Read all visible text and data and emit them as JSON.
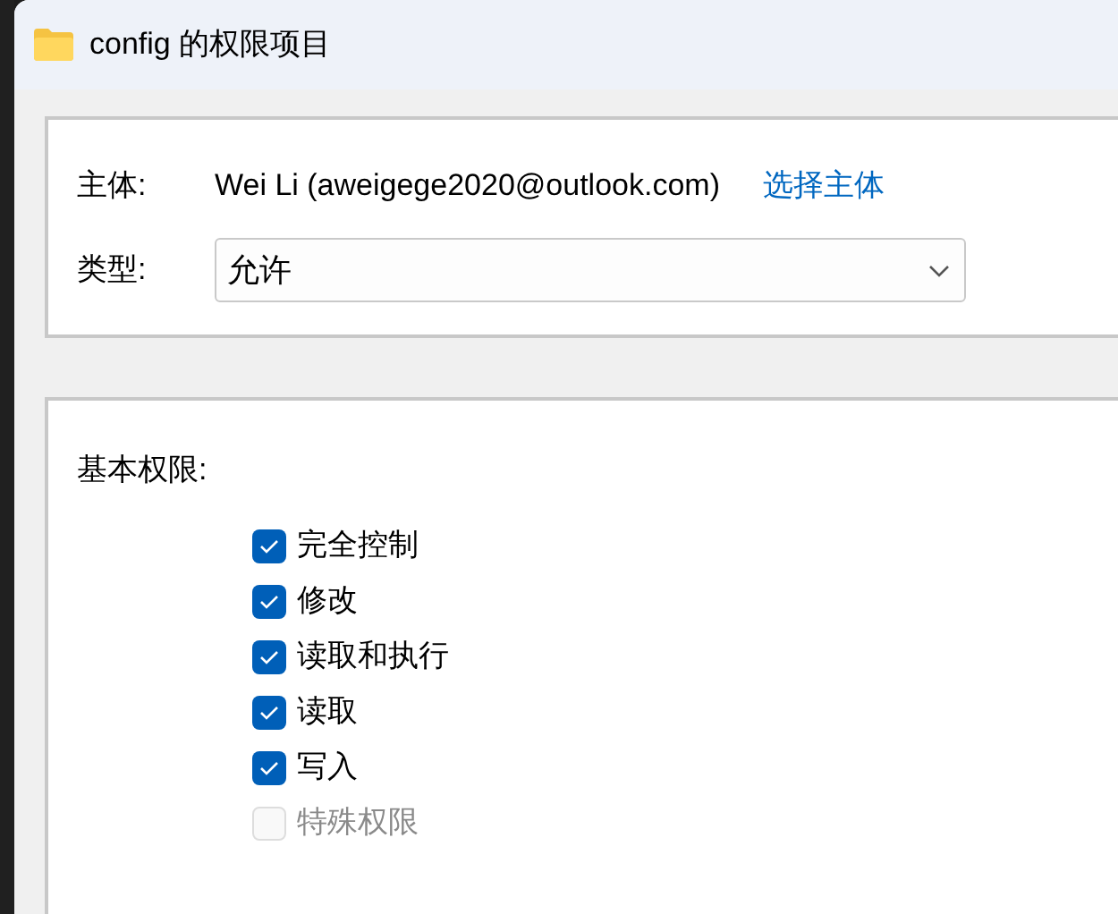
{
  "window": {
    "title": "config 的权限项目"
  },
  "principal": {
    "label": "主体:",
    "value": "Wei Li (aweigege2020@outlook.com)",
    "link": "选择主体"
  },
  "type": {
    "label": "类型:",
    "value": "允许"
  },
  "basic_permissions": {
    "label": "基本权限:",
    "items": [
      {
        "label": "完全控制",
        "checked": true,
        "disabled": false
      },
      {
        "label": "修改",
        "checked": true,
        "disabled": false
      },
      {
        "label": "读取和执行",
        "checked": true,
        "disabled": false
      },
      {
        "label": "读取",
        "checked": true,
        "disabled": false
      },
      {
        "label": "写入",
        "checked": true,
        "disabled": false
      },
      {
        "label": "特殊权限",
        "checked": false,
        "disabled": true
      }
    ]
  }
}
